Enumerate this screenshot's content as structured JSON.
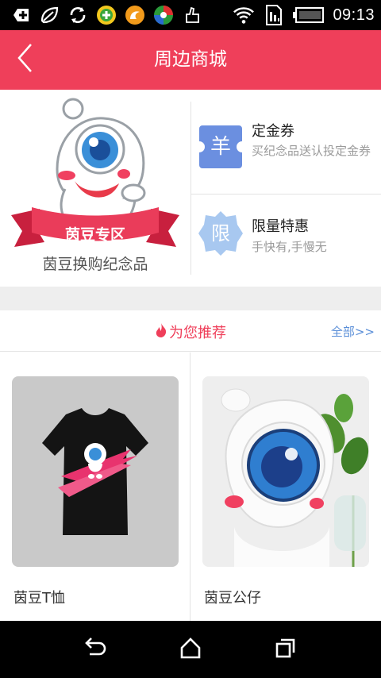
{
  "status_bar": {
    "time": "09:13",
    "icons": [
      "add-box-icon",
      "leaf-icon",
      "sync-icon",
      "plus-circle-app-icon",
      "uc-squirrel-icon",
      "ball-app-icon",
      "pointing-hand-icon",
      "wifi-icon",
      "sim-storage-icon",
      "battery-icon"
    ]
  },
  "header": {
    "title": "周边商城",
    "back_icon": "chevron-left-icon"
  },
  "promo": {
    "mascot_banner": "茵豆专区",
    "caption": "茵豆换购纪念品",
    "items": [
      {
        "icon_text": "羊",
        "icon_color": "#6b8fe0",
        "title": "定金券",
        "subtitle": "买纪念品送认投定金券"
      },
      {
        "icon_text": "限",
        "icon_color": "#a8c8f0",
        "title": "限量特惠",
        "subtitle": "手快有,手慢无"
      }
    ]
  },
  "recommend": {
    "title": "为您推荐",
    "more": "全部>>"
  },
  "products": [
    {
      "name": "茵豆T恤"
    },
    {
      "name": "茵豆公仔"
    }
  ],
  "colors": {
    "brand": "#ef3f5a",
    "link": "#5b8fd8"
  }
}
